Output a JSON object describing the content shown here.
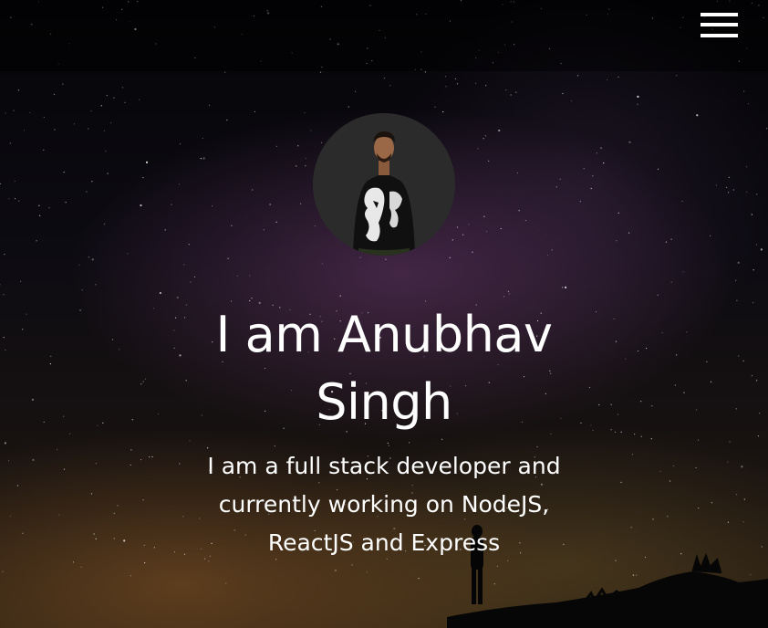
{
  "navbar": {
    "menu_icon": "hamburger-menu-icon"
  },
  "hero": {
    "avatar_icon": "profile-photo",
    "headline": "I am Anubhav Singh",
    "tagline": "I am a full stack developer and currently working on NodeJS, ReactJS and Express"
  },
  "colors": {
    "text": "#ffffff",
    "background": "#0a0a0f",
    "navbar": "#000000"
  }
}
